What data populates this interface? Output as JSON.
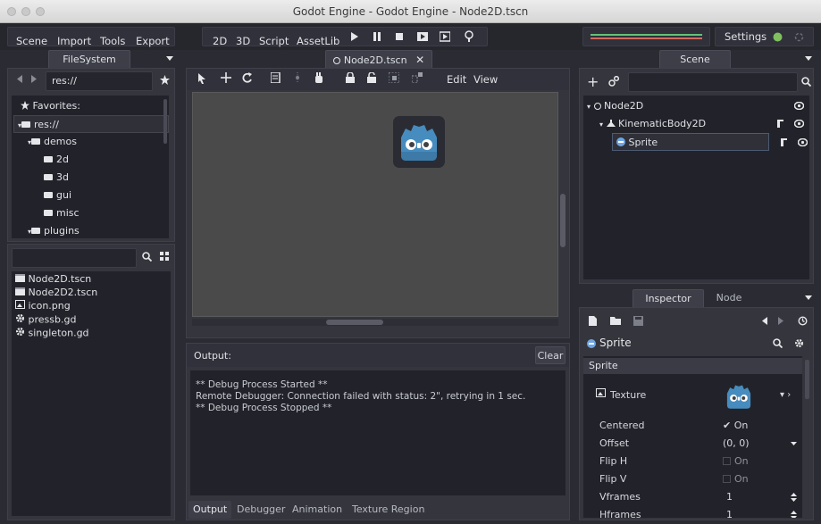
{
  "window": {
    "title": "Godot Engine - Godot Engine - Node2D.tscn"
  },
  "menu": {
    "scene": "Scene",
    "import": "Import",
    "tools": "Tools",
    "export": "Export"
  },
  "modes": {
    "m2d": "2D",
    "m3d": "3D",
    "script": "Script",
    "assetlib": "AssetLib"
  },
  "settings": {
    "label": "Settings"
  },
  "filesystem": {
    "tab": "FileSystem",
    "path": "res://",
    "favorites": "Favorites:",
    "tree": [
      {
        "label": "res://"
      },
      {
        "label": "demos"
      },
      {
        "label": "2d"
      },
      {
        "label": "3d"
      },
      {
        "label": "gui"
      },
      {
        "label": "misc"
      },
      {
        "label": "plugins"
      }
    ],
    "search_value": "",
    "files": [
      {
        "label": "Node2D.tscn",
        "icon": "scene-icon"
      },
      {
        "label": "Node2D2.tscn",
        "icon": "scene-icon"
      },
      {
        "label": "icon.png",
        "icon": "image-icon"
      },
      {
        "label": "pressb.gd",
        "icon": "gear-icon"
      },
      {
        "label": "singleton.gd",
        "icon": "gear-icon"
      }
    ]
  },
  "editor": {
    "tab": "Node2D.tscn",
    "toolbar_edit": "Edit",
    "toolbar_view": "View"
  },
  "output": {
    "title": "Output:",
    "clear": "Clear",
    "lines": [
      "** Debug Process Started **",
      "Remote Debugger: Connection failed with status: 2\", retrying in 1 sec.",
      "** Debug Process Stopped **"
    ],
    "bottom_tabs": [
      "Output",
      "Debugger",
      "Animation",
      "Texture Region"
    ]
  },
  "scene": {
    "tab": "Scene",
    "search_value": "",
    "nodes": [
      {
        "label": "Node2D"
      },
      {
        "label": "KinematicBody2D"
      },
      {
        "label": "Sprite"
      }
    ]
  },
  "inspector": {
    "tab_inspector": "Inspector",
    "tab_node": "Node",
    "object": "Sprite",
    "section": "Sprite",
    "texture_label": "Texture",
    "props": [
      {
        "label": "Centered",
        "value": "On",
        "checked": true
      },
      {
        "label": "Offset",
        "value": "(0, 0)"
      },
      {
        "label": "Flip H",
        "value": "On",
        "checked": false
      },
      {
        "label": "Flip V",
        "value": "On",
        "checked": false
      },
      {
        "label": "Vframes",
        "value": "1"
      },
      {
        "label": "Hframes",
        "value": "1"
      }
    ]
  },
  "colors": {
    "accent": "#6ea5e5",
    "background": "#2b2c33",
    "panel": "#34353d",
    "viewport": "#4a4a4a",
    "godot_blue": "#478cbf"
  }
}
